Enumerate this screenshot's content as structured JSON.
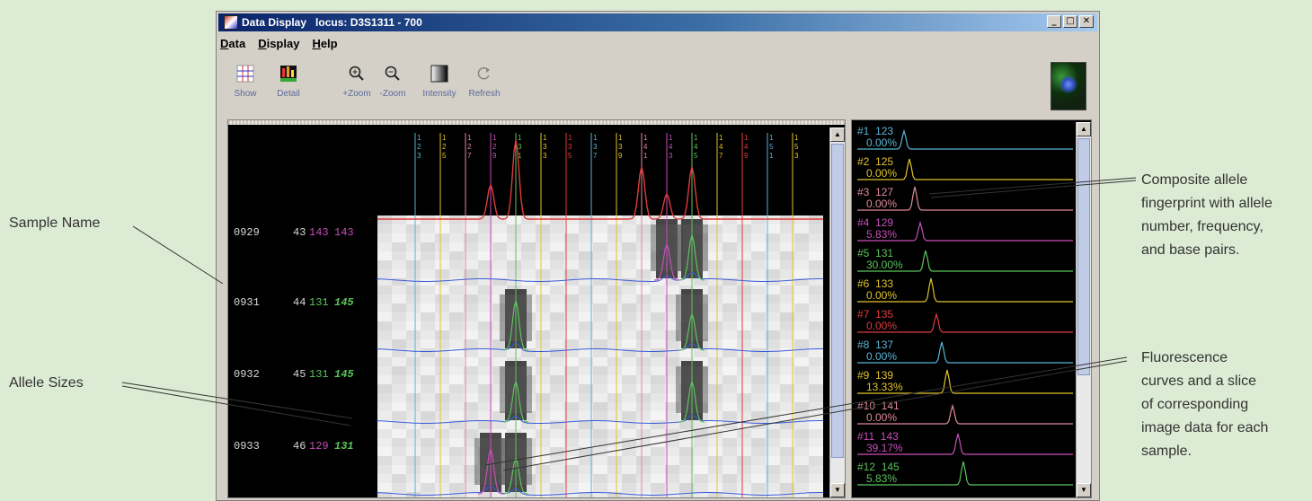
{
  "window": {
    "title": "Data Display   locus: D3S1311 - 700",
    "controls": [
      "_",
      "□",
      "✕"
    ]
  },
  "menu": [
    "Data",
    "Display",
    "Help"
  ],
  "toolbar": [
    {
      "label": "Show",
      "icon": "show-icon"
    },
    {
      "label": "Detail",
      "icon": "detail-icon"
    },
    {
      "label": "+Zoom",
      "icon": "zoom-in-icon"
    },
    {
      "label": "-Zoom",
      "icon": "zoom-out-icon"
    },
    {
      "label": "Intensity",
      "icon": "intensity-icon"
    },
    {
      "label": "Refresh",
      "icon": "refresh-icon"
    }
  ],
  "allele_columns": [
    {
      "label": "123",
      "color": "#5ab4d6"
    },
    {
      "label": "125",
      "color": "#e2c42a"
    },
    {
      "label": "127",
      "color": "#e08a9a"
    },
    {
      "label": "129",
      "color": "#c64fba"
    },
    {
      "label": "131",
      "color": "#5cc35c"
    },
    {
      "label": "133",
      "color": "#e2c42a"
    },
    {
      "label": "135",
      "color": "#e03c3c"
    },
    {
      "label": "137",
      "color": "#5ab4d6"
    },
    {
      "label": "139",
      "color": "#e2c42a"
    },
    {
      "label": "141",
      "color": "#e08a9a"
    },
    {
      "label": "143",
      "color": "#c64fba"
    },
    {
      "label": "145",
      "color": "#5cc35c"
    },
    {
      "label": "147",
      "color": "#e2c42a"
    },
    {
      "label": "149",
      "color": "#e03c3c"
    },
    {
      "label": "151",
      "color": "#5ab4d6"
    },
    {
      "label": "153",
      "color": "#e2c42a"
    }
  ],
  "samples": [
    {
      "name": "0929",
      "num": "43",
      "a1": "143",
      "a2": "143",
      "c1": "#c64fba",
      "c2": "#c64fba",
      "bold2": false
    },
    {
      "name": "0931",
      "num": "44",
      "a1": "131",
      "a2": "145",
      "c1": "#5cc35c",
      "c2": "#5cc35c",
      "bold2": true
    },
    {
      "name": "0932",
      "num": "45",
      "a1": "131",
      "a2": "145",
      "c1": "#5cc35c",
      "c2": "#5cc35c",
      "bold2": true
    },
    {
      "name": "0933",
      "num": "46",
      "a1": "129",
      "a2": "131",
      "c1": "#c64fba",
      "c2": "#5cc35c",
      "bold2": true
    }
  ],
  "composite": [
    {
      "id": "#1",
      "bp": "123",
      "freq": "0.00%",
      "color": "#5ab4d6"
    },
    {
      "id": "#2",
      "bp": "125",
      "freq": "0.00%",
      "color": "#e2c42a"
    },
    {
      "id": "#3",
      "bp": "127",
      "freq": "0.00%",
      "color": "#e08a9a"
    },
    {
      "id": "#4",
      "bp": "129",
      "freq": "5.83%",
      "color": "#c64fba"
    },
    {
      "id": "#5",
      "bp": "131",
      "freq": "30.00%",
      "color": "#5cc35c"
    },
    {
      "id": "#6",
      "bp": "133",
      "freq": "0.00%",
      "color": "#e2c42a"
    },
    {
      "id": "#7",
      "bp": "135",
      "freq": "0.00%",
      "color": "#e03c3c"
    },
    {
      "id": "#8",
      "bp": "137",
      "freq": "0.00%",
      "color": "#5ab4d6"
    },
    {
      "id": "#9",
      "bp": "139",
      "freq": "13.33%",
      "color": "#e2c42a"
    },
    {
      "id": "#10",
      "bp": "141",
      "freq": "0.00%",
      "color": "#e08a9a"
    },
    {
      "id": "#11",
      "bp": "143",
      "freq": "39.17%",
      "color": "#c64fba"
    },
    {
      "id": "#12",
      "bp": "145",
      "freq": "5.83%",
      "color": "#5cc35c"
    }
  ],
  "annotations": {
    "sample_name": "Sample Name",
    "allele_sizes": "Allele Sizes",
    "composite": [
      "Composite allele",
      "fingerprint with allele",
      "number, frequency,",
      "and base pairs."
    ],
    "fluorescence": [
      "Fluorescence",
      "curves and a slice",
      "of corresponding",
      "image data for each",
      "sample."
    ]
  },
  "colors": {
    "baseline": "#3a5bd9",
    "composite_curve": "#e03c3c",
    "desktop": "#dcebd3"
  }
}
